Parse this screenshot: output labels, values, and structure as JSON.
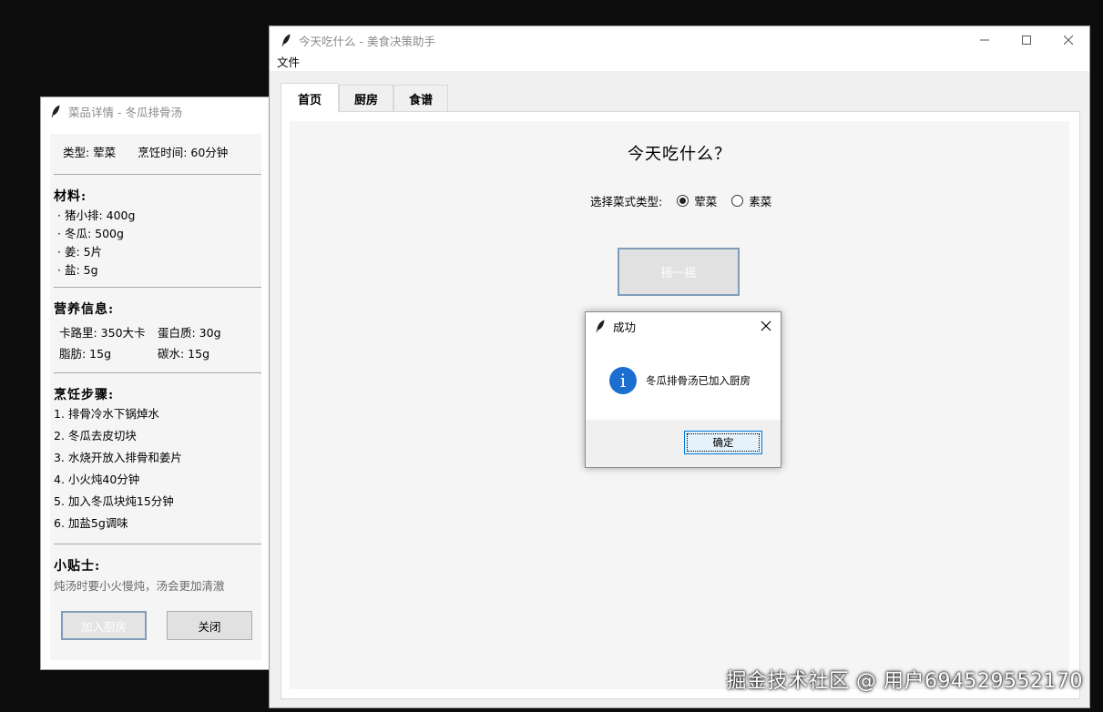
{
  "detail_window": {
    "title": "菜品详情 - 冬瓜排骨汤",
    "type_text": "类型: 荤菜",
    "time_text": "烹饪时间: 60分钟",
    "ingredients_title": "材料:",
    "ingredients": [
      "· 猪小排: 400g",
      "· 冬瓜: 500g",
      "· 姜: 5片",
      "· 盐: 5g"
    ],
    "nutrition_title": "营养信息:",
    "nutrition": {
      "calories": "卡路里: 350大卡",
      "protein": "蛋白质: 30g",
      "fat": "脂肪: 15g",
      "carbs": "碳水: 15g"
    },
    "steps_title": "烹饪步骤:",
    "steps": [
      "1. 排骨冷水下锅焯水",
      "2. 冬瓜去皮切块",
      "3. 水烧开放入排骨和姜片",
      "4. 小火炖40分钟",
      "5. 加入冬瓜块炖15分钟",
      "6. 加盐5g调味"
    ],
    "tips_title": "小贴士:",
    "tips_text": "炖汤时要小火慢炖，汤会更加清澈",
    "add_label": "加入厨房",
    "close_label": "关闭"
  },
  "main_window": {
    "title": "今天吃什么 - 美食决策助手",
    "menu_file": "文件",
    "tabs": [
      {
        "label": "首页",
        "active": true
      },
      {
        "label": "厨房",
        "active": false
      },
      {
        "label": "食谱",
        "active": false
      }
    ],
    "home": {
      "heading": "今天吃什么？",
      "type_label": "选择菜式类型:",
      "option_meat": "荤菜",
      "option_veg": "素菜",
      "selected": "荤菜",
      "shake_label": "摇一摇"
    }
  },
  "message_box": {
    "title": "成功",
    "message": "冬瓜排骨汤已加入厨房",
    "ok_label": "确定",
    "icon": "info-icon"
  },
  "watermark": "掘金技术社区 @ 用户694529552170",
  "colors": {
    "desktop": "#0c0c0c",
    "info_blue": "#1a6fd1",
    "focus_border": "#0078d7",
    "button_border": "#7f9db9"
  }
}
